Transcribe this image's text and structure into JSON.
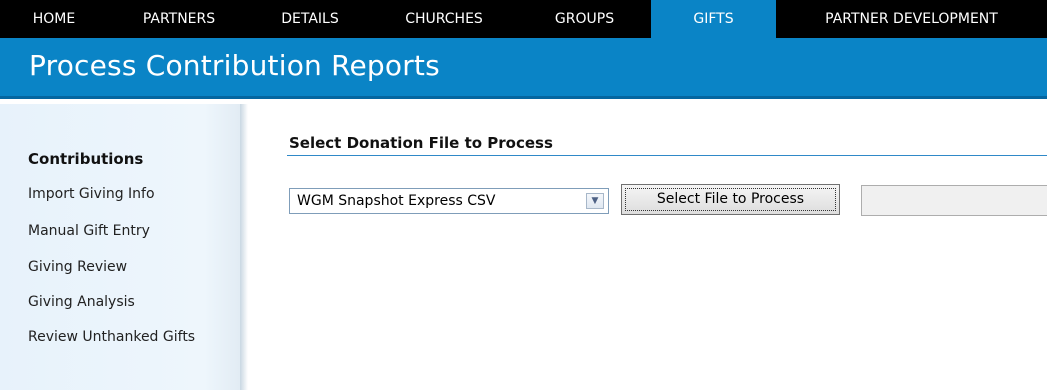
{
  "nav": {
    "items": [
      {
        "label": "HOME"
      },
      {
        "label": "PARTNERS"
      },
      {
        "label": "DETAILS"
      },
      {
        "label": "CHURCHES"
      },
      {
        "label": "GROUPS"
      },
      {
        "label": "GIFTS",
        "active": true
      },
      {
        "label": "PARTNER DEVELOPMENT"
      }
    ]
  },
  "header": {
    "title": "Process Contribution Reports"
  },
  "sidebar": {
    "heading": "Contributions",
    "items": [
      {
        "label": "Import Giving Info"
      },
      {
        "label": "Manual Gift Entry"
      },
      {
        "label": "Giving Review"
      },
      {
        "label": "Giving Analysis"
      },
      {
        "label": "Review Unthanked Gifts"
      }
    ]
  },
  "main": {
    "section_title": "Select Donation File to Process",
    "file_type_select": {
      "value": "WGM Snapshot Express CSV"
    },
    "select_file_button": "Select File to Process",
    "file_path_value": ""
  },
  "colors": {
    "accent": "#0a84c6",
    "nav_bg": "#000000",
    "sidebar_bg": "#e7f2fb"
  }
}
